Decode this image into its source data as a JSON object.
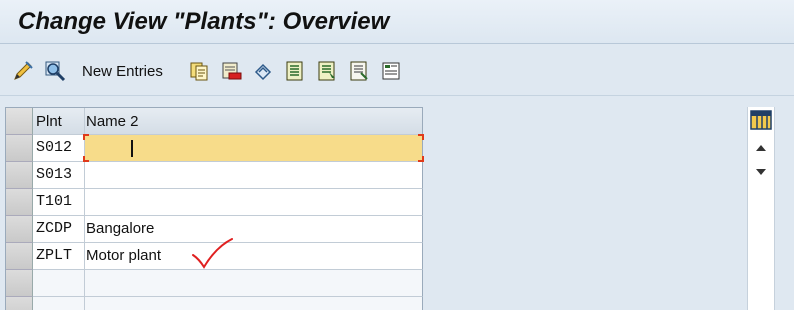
{
  "window": {
    "title": "Change View \"Plants\": Overview"
  },
  "toolbar": {
    "new_entries_label": "New Entries",
    "icons": [
      "display-change-icon",
      "find-icon",
      "copy-as-icon",
      "delete-icon",
      "undo-change-icon",
      "select-all-icon",
      "select-block-icon",
      "deselect-all-icon",
      "print-standard-list-icon"
    ]
  },
  "table": {
    "columns": [
      "Plnt",
      "Name 2"
    ],
    "rows": [
      {
        "plnt": "S012",
        "name2": ""
      },
      {
        "plnt": "S013",
        "name2": ""
      },
      {
        "plnt": "T101",
        "name2": ""
      },
      {
        "plnt": "ZCDP",
        "name2": "Bangalore"
      },
      {
        "plnt": "ZPLT",
        "name2": "Motor plant"
      }
    ]
  },
  "colors": {
    "active_cell": "#f7dc8a",
    "annotation": "#e02020"
  }
}
